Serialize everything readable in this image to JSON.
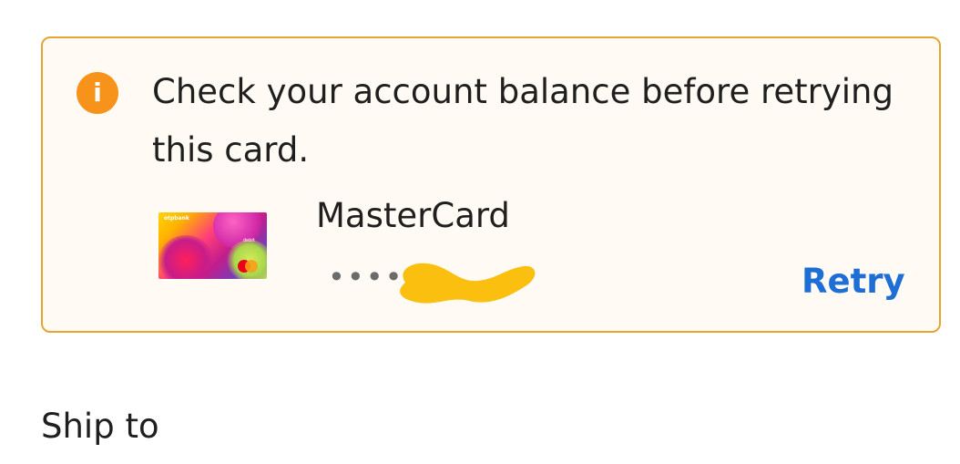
{
  "alert": {
    "icon": "info-icon",
    "icon_glyph": "i",
    "message": "Check your account balance before retrying this card.",
    "border_color": "#e5a533",
    "background_color": "#fffbf4"
  },
  "card": {
    "brand": "MasterCard",
    "masked_number": "••••",
    "image_bank_label": "otpbank",
    "image_type_label": "debit",
    "retry_label": "Retry"
  },
  "colors": {
    "accent": "#1d6fd6",
    "warning": "#f7931a"
  },
  "shipping": {
    "heading": "Ship to"
  }
}
